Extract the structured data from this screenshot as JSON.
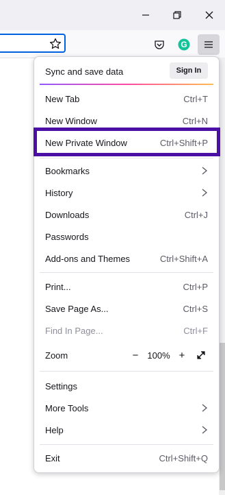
{
  "window": {
    "minimize_icon": "minimize-icon",
    "restore_icon": "restore-icon",
    "close_icon": "close-icon"
  },
  "menu": {
    "sync": {
      "label": "Sync and save data",
      "signin_label": "Sign In"
    },
    "items": [
      {
        "label": "New Tab",
        "shortcut": "Ctrl+T"
      },
      {
        "label": "New Window",
        "shortcut": "Ctrl+N"
      },
      {
        "label": "New Private Window",
        "shortcut": "Ctrl+Shift+P"
      },
      {
        "label": "Bookmarks",
        "shortcut": ""
      },
      {
        "label": "History",
        "shortcut": ""
      },
      {
        "label": "Downloads",
        "shortcut": "Ctrl+J"
      },
      {
        "label": "Passwords",
        "shortcut": ""
      },
      {
        "label": "Add-ons and Themes",
        "shortcut": "Ctrl+Shift+A"
      },
      {
        "label": "Print...",
        "shortcut": "Ctrl+P"
      },
      {
        "label": "Save Page As...",
        "shortcut": "Ctrl+S"
      },
      {
        "label": "Find In Page...",
        "shortcut": "Ctrl+F"
      },
      {
        "label": "Zoom",
        "shortcut": ""
      },
      {
        "label": "Settings",
        "shortcut": ""
      },
      {
        "label": "More Tools",
        "shortcut": ""
      },
      {
        "label": "Help",
        "shortcut": ""
      },
      {
        "label": "Exit",
        "shortcut": "Ctrl+Shift+Q"
      }
    ],
    "zoom": {
      "minus": "−",
      "value": "100%",
      "plus": "+"
    }
  },
  "colors": {
    "highlight": "#4b0fa6",
    "accent": "#0061e0"
  }
}
